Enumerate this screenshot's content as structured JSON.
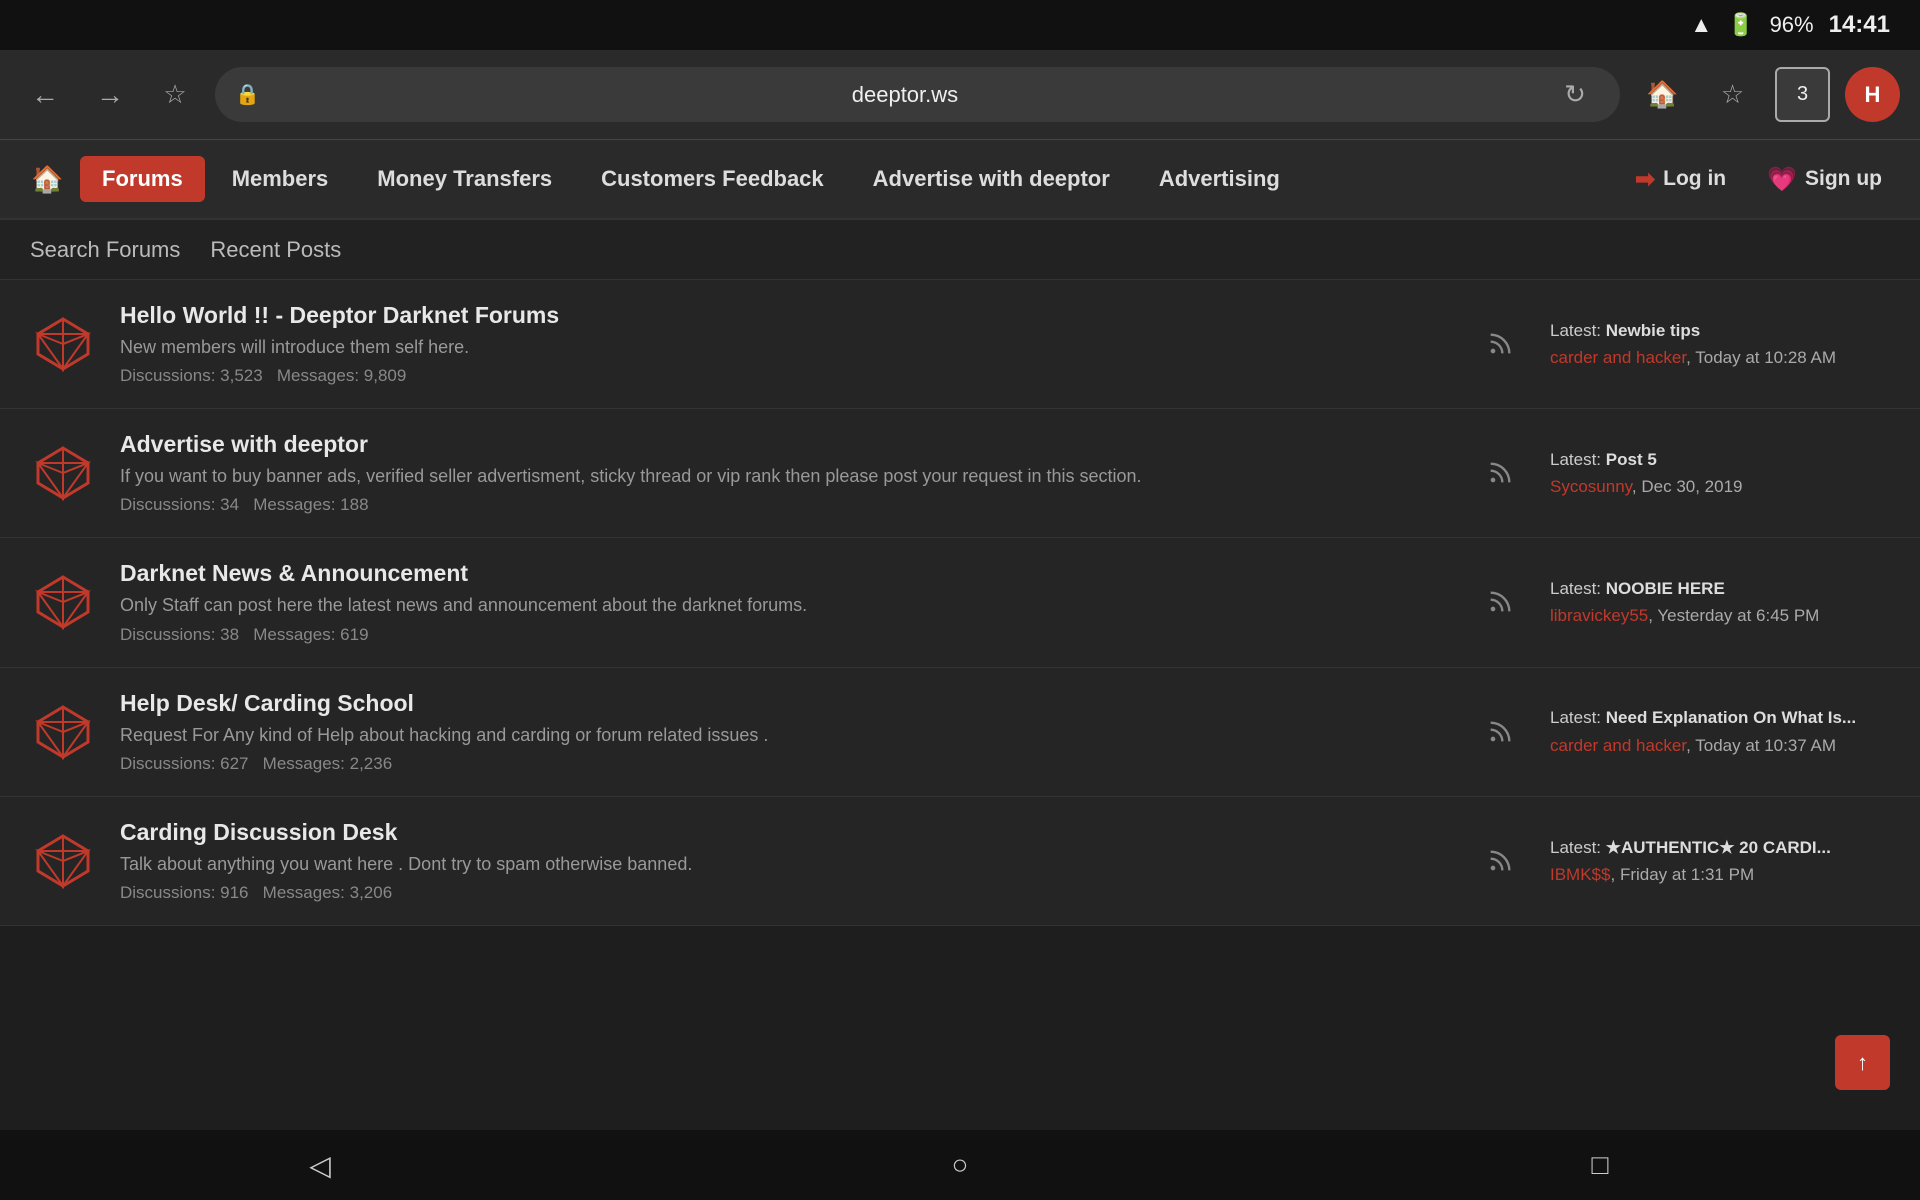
{
  "statusBar": {
    "wifi": "wifi",
    "battery": "96%",
    "time": "14:41"
  },
  "browserChrome": {
    "url": "deeptor.ws",
    "tabCount": "3",
    "avatarLetter": "H"
  },
  "nav": {
    "homeIcon": "🏠",
    "items": [
      {
        "id": "forums",
        "label": "Forums",
        "active": true
      },
      {
        "id": "members",
        "label": "Members",
        "active": false
      },
      {
        "id": "money-transfers",
        "label": "Money Transfers",
        "active": false
      },
      {
        "id": "customers-feedback",
        "label": "Customers Feedback",
        "active": false
      },
      {
        "id": "advertise",
        "label": "Advertise with deeptor",
        "active": false
      },
      {
        "id": "advertising",
        "label": "Advertising",
        "active": false
      }
    ],
    "loginLabel": "Log in",
    "signupLabel": "Sign up"
  },
  "subNav": {
    "items": [
      {
        "id": "search-forums",
        "label": "Search Forums"
      },
      {
        "id": "recent-posts",
        "label": "Recent Posts"
      }
    ]
  },
  "forums": [
    {
      "id": "hello-world",
      "title": "Hello World !! - Deeptor Darknet Forums",
      "desc": "New members will introduce them self here.",
      "discussions": "3,523",
      "messages": "9,809",
      "latestTitle": "Newbie tips",
      "latestUser": "carder and hacker",
      "latestTime": "Today at 10:28 AM"
    },
    {
      "id": "advertise-deeptor",
      "title": "Advertise with deeptor",
      "desc": "If you want to buy banner ads, verified seller advertisment, sticky thread or vip rank then please post your request in this section.",
      "discussions": "34",
      "messages": "188",
      "latestTitle": "Post 5",
      "latestUser": "Sycosunny",
      "latestTime": "Dec 30, 2019"
    },
    {
      "id": "darknet-news",
      "title": "Darknet News & Announcement",
      "desc": "Only Staff can post here the latest news and announcement about the darknet forums.",
      "discussions": "38",
      "messages": "619",
      "latestTitle": "NOOBIE HERE",
      "latestUser": "libravickey55",
      "latestTime": "Yesterday at 6:45 PM"
    },
    {
      "id": "help-desk",
      "title": "Help Desk/ Carding School",
      "desc": "Request For Any kind of Help about hacking and carding or forum related issues .",
      "discussions": "627",
      "messages": "2,236",
      "latestTitle": "Need Explanation On What Is...",
      "latestUser": "carder and hacker",
      "latestTime": "Today at 10:37 AM"
    },
    {
      "id": "carding-discussion",
      "title": "Carding Discussion Desk",
      "desc": "Talk about anything you want here . Dont try to spam otherwise banned.",
      "discussions": "916",
      "messages": "3,206",
      "latestTitle": "★AUTHENTIC★ 20 CARDI...",
      "latestUser": "IBMK$$",
      "latestTime": "Friday at 1:31 PM"
    }
  ],
  "scrollTop": "↑",
  "androidNav": {
    "back": "◁",
    "home": "○",
    "recents": "□"
  }
}
